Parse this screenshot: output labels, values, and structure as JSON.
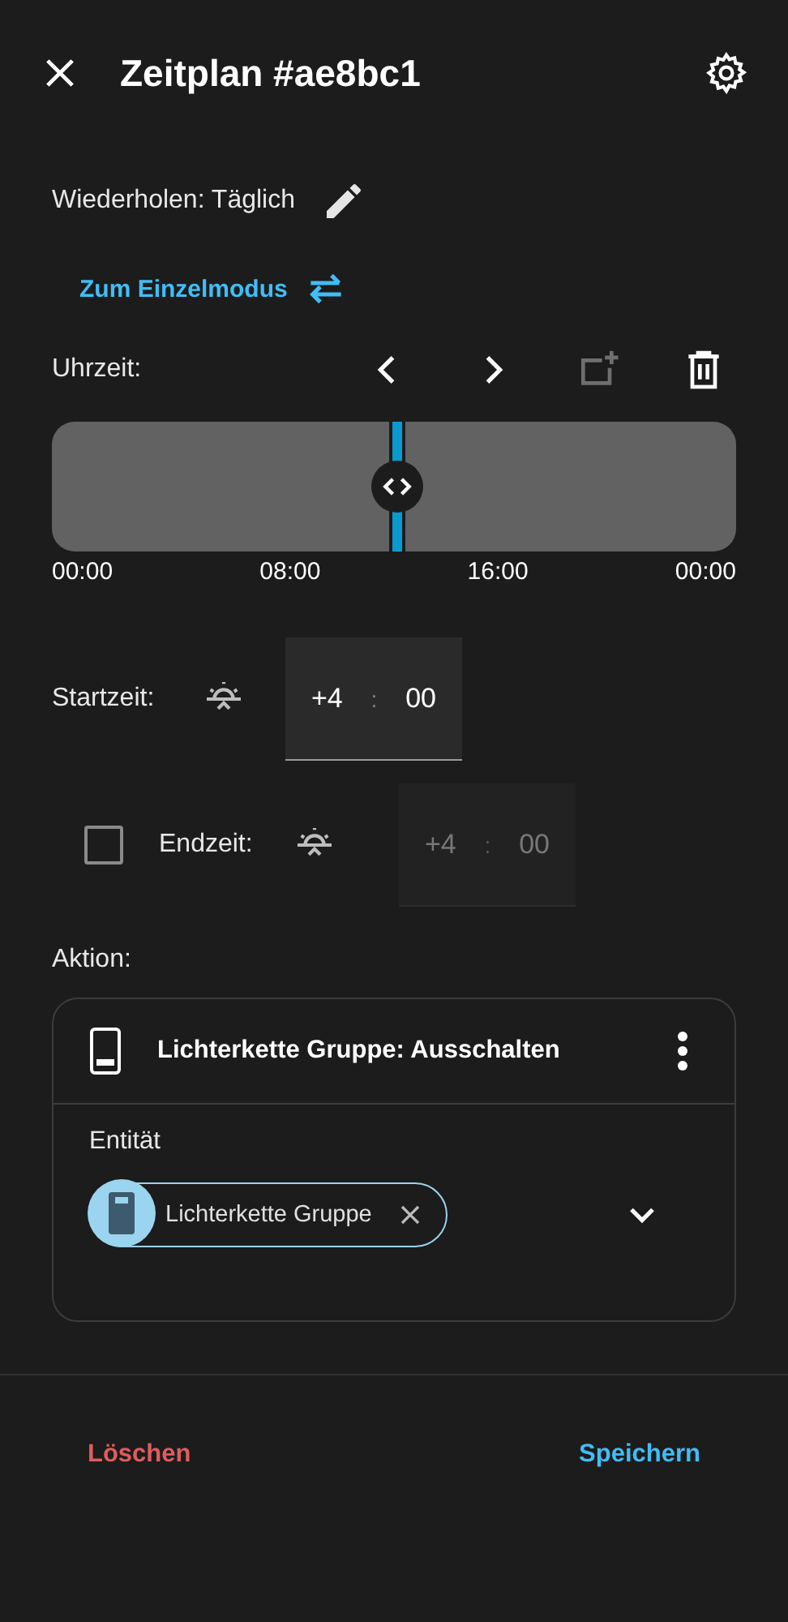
{
  "header": {
    "title": "Zeitplan #ae8bc1"
  },
  "repeat": {
    "label": "Wiederholen: Täglich"
  },
  "mode_link": {
    "label": "Zum Einzelmodus"
  },
  "time": {
    "label": "Uhrzeit:",
    "add_disabled": true
  },
  "timeline": {
    "level": 0.505,
    "ticks": [
      "00:00",
      "08:00",
      "16:00",
      "00:00"
    ]
  },
  "start": {
    "label": "Startzeit:",
    "hours": "+4",
    "separator": ":",
    "minutes": "00",
    "disabled": false
  },
  "end": {
    "label": "Endzeit:",
    "checked": false,
    "hours": "+4",
    "separator": ":",
    "minutes": "00",
    "disabled": true
  },
  "action": {
    "label": "Aktion:",
    "title": "Lichterkette Gruppe: Ausschalten",
    "entity_label": "Entität",
    "chip": "Lichterkette Gruppe"
  },
  "footer": {
    "delete": "Löschen",
    "save": "Speichern"
  }
}
